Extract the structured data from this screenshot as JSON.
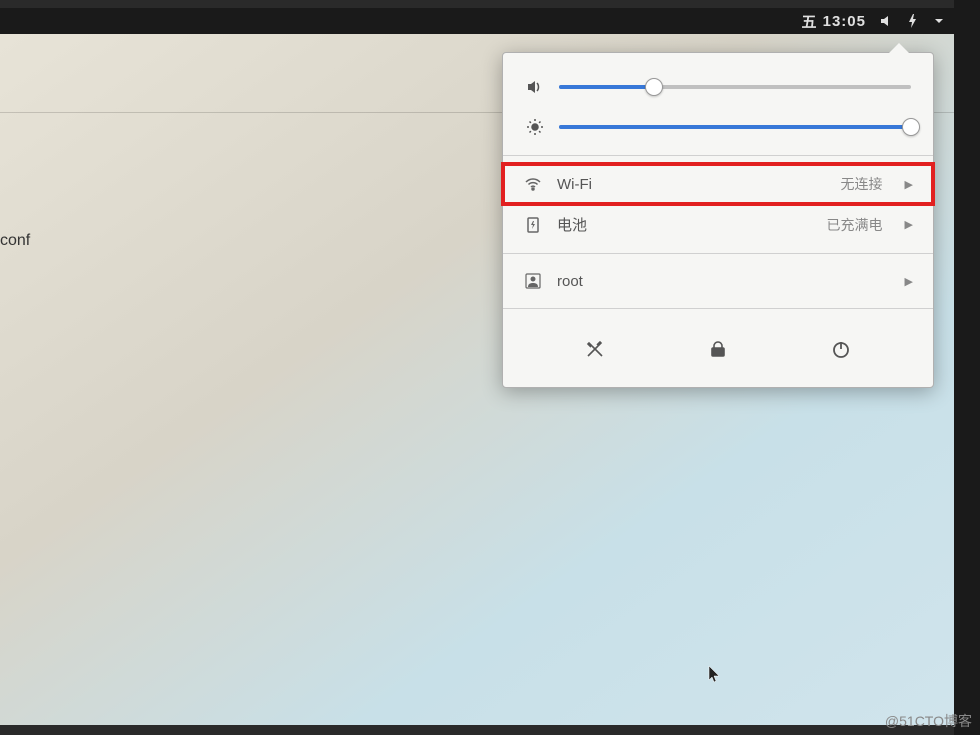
{
  "topbar": {
    "day": "五",
    "time": "13:05"
  },
  "left_content": {
    "text": "conf"
  },
  "sliders": {
    "volume_percent": 27,
    "brightness_percent": 100
  },
  "menu": {
    "wifi": {
      "label": "Wi-Fi",
      "status": "无连接"
    },
    "battery": {
      "label": "电池",
      "status": "已充满电"
    },
    "user": {
      "label": "root"
    }
  },
  "watermark": "@51CTO博客"
}
